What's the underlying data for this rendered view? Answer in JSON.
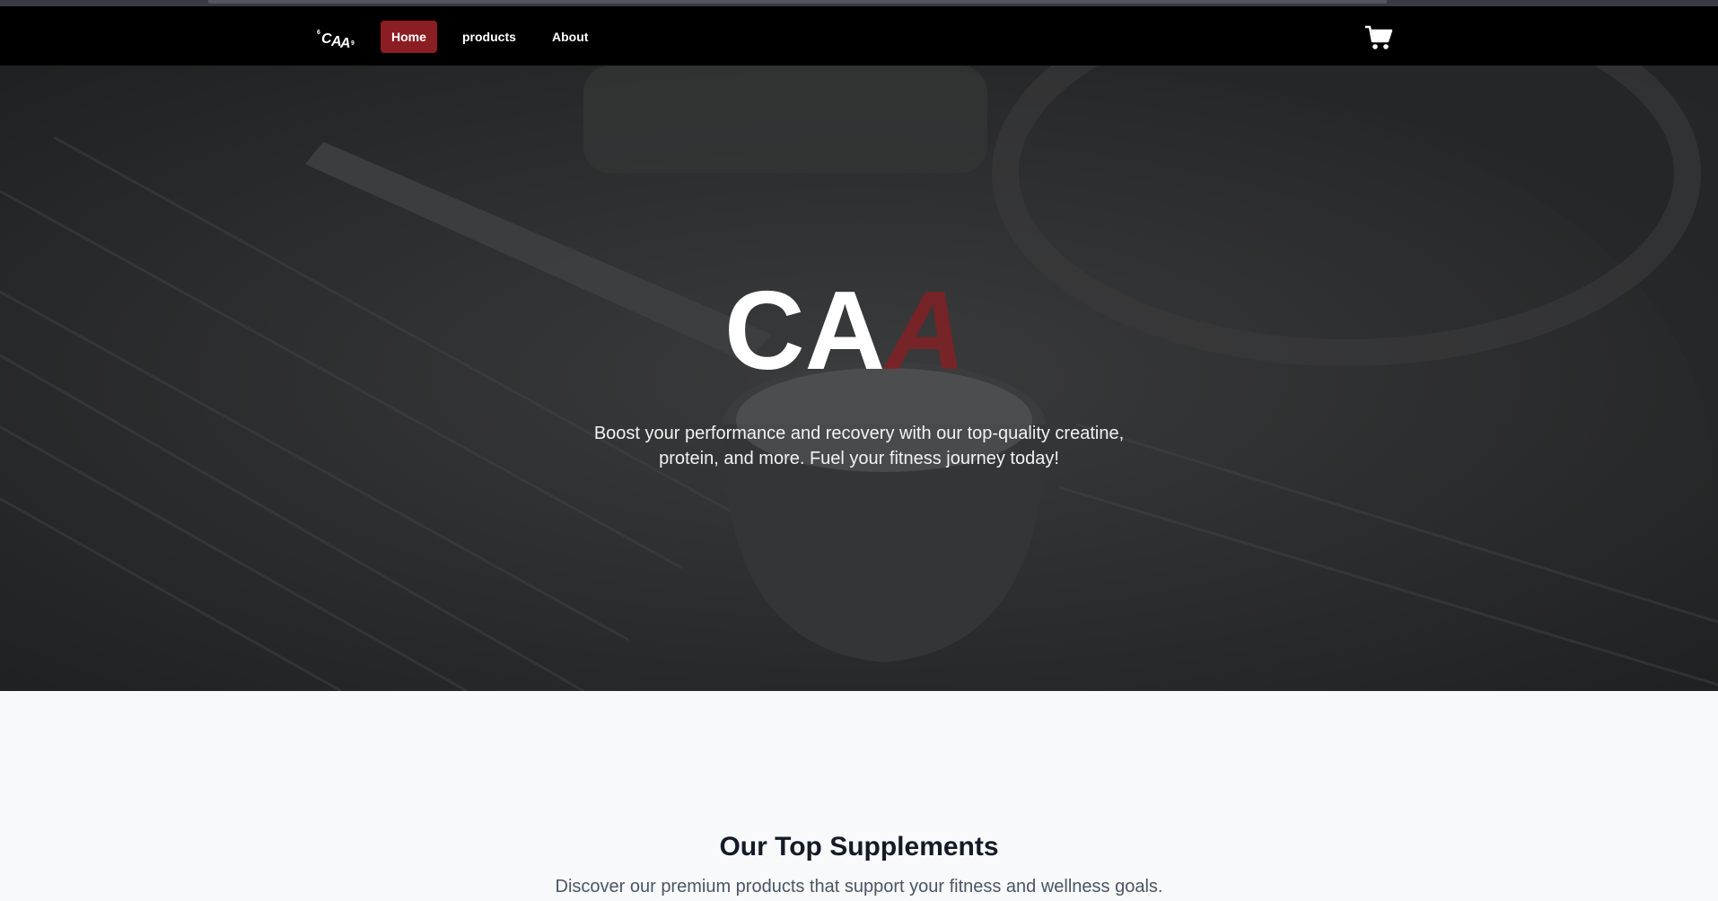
{
  "nav": {
    "logo_text": "CAA",
    "links": [
      {
        "label": "Home",
        "active": true
      },
      {
        "label": "products",
        "active": false
      },
      {
        "label": "About",
        "active": false
      }
    ],
    "cart_icon": "shopping-cart-icon"
  },
  "hero": {
    "title": "CAA",
    "title_accent_color": "#8b1e22",
    "description": "Boost your performance and recovery with our top-quality creatine, protein, and more. Fuel your fitness journey today!"
  },
  "section": {
    "title": "Our Top Supplements",
    "subtitle": "Discover our premium products that support your fitness and wellness goals."
  },
  "colors": {
    "navbar": "#000000",
    "active_nav": "#8b1e22",
    "page_background": "#f8f9fb"
  }
}
